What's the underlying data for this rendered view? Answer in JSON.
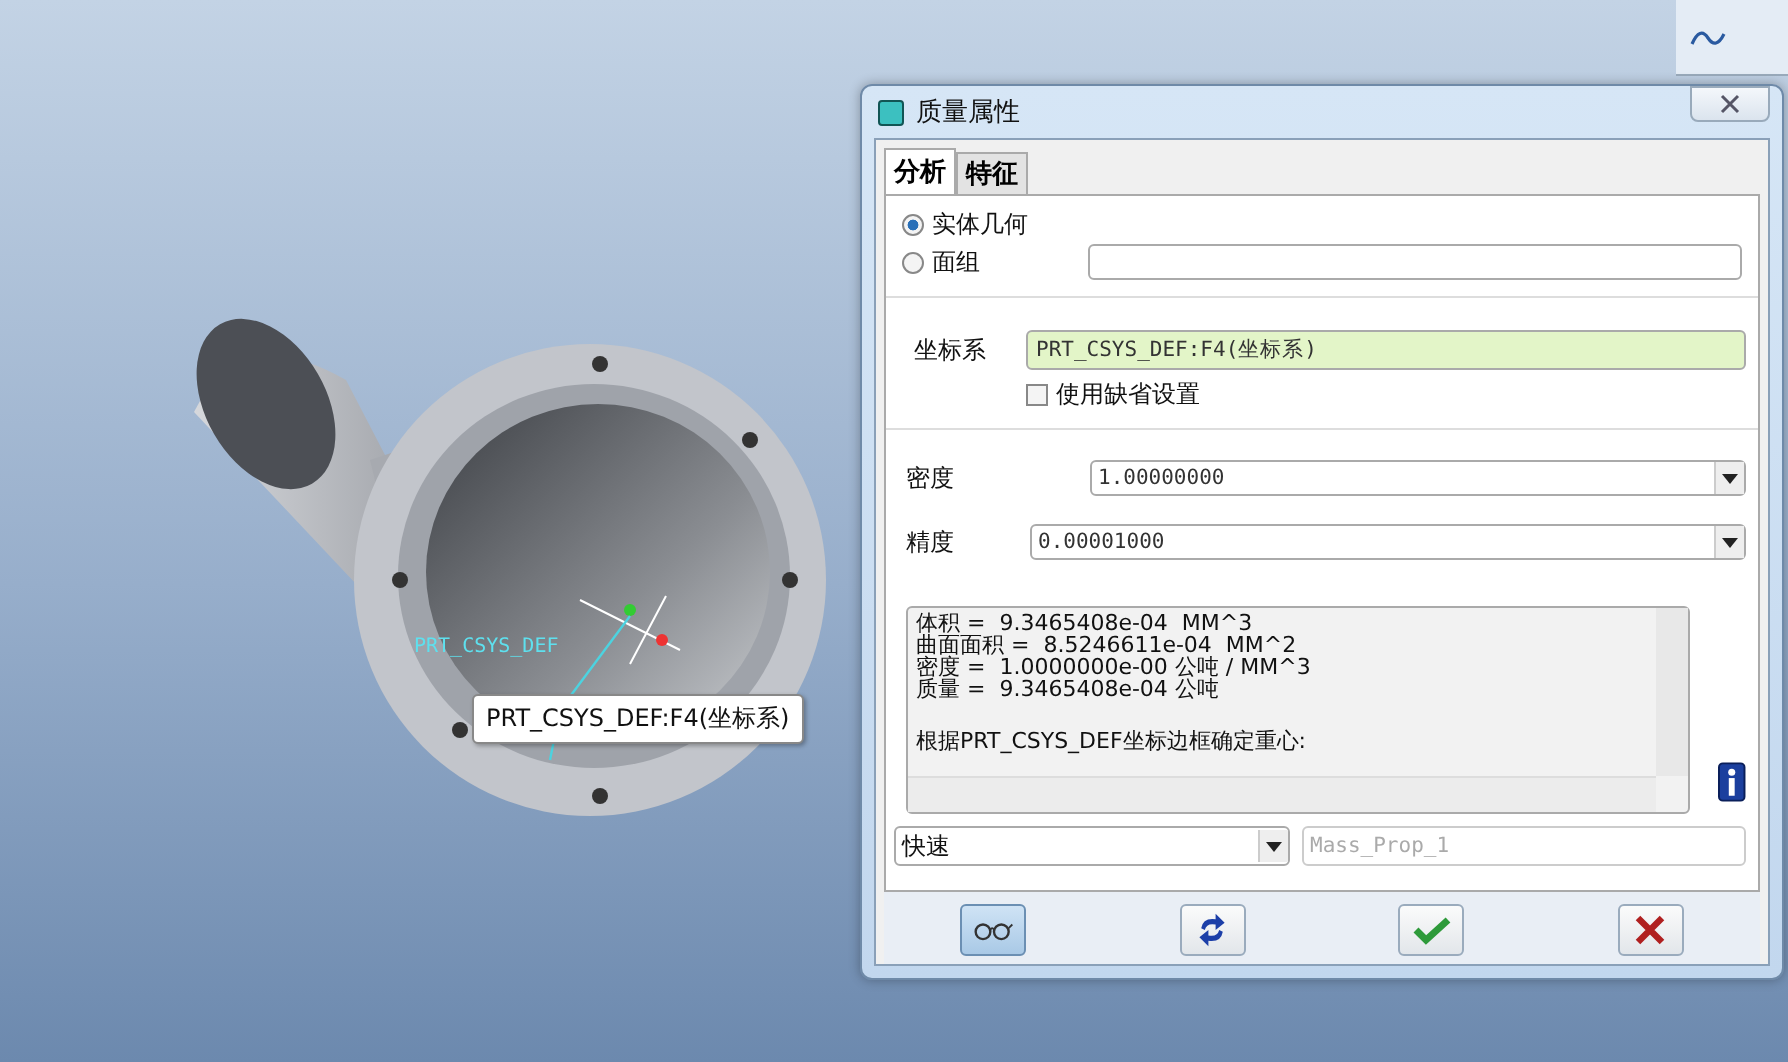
{
  "viewport": {
    "csys_label": "PRT_CSYS_DEF",
    "tooltip": "PRT_CSYS_DEF:F4(坐标系)"
  },
  "window": {
    "title": "质量属性"
  },
  "tabs": [
    {
      "label": "分析",
      "selected": true
    },
    {
      "label": "特征",
      "selected": false
    }
  ],
  "geometry_options": [
    {
      "label": "实体几何",
      "selected": true
    },
    {
      "label": "面组",
      "selected": false
    }
  ],
  "coordinate_system": {
    "label": "坐标系",
    "value": "PRT_CSYS_DEF:F4(坐标系)",
    "use_default": {
      "label": "使用缺省设置",
      "checked": false
    }
  },
  "density": {
    "label": "密度",
    "value": "1.00000000"
  },
  "accuracy": {
    "label": "精度",
    "value": "0.00001000"
  },
  "results": [
    "体积 =  9.3465408e-04  MM^3",
    "曲面面积 =  8.5246611e-04  MM^2",
    "密度 =  1.0000000e-00 公吨 / MM^3",
    "质量 =  9.3465408e-04 公吨",
    "根据PRT_CSYS_DEF坐标边框确定重心:"
  ],
  "mode": {
    "value": "快速"
  },
  "name_field": {
    "placeholder": "Mass_Prop_1"
  }
}
